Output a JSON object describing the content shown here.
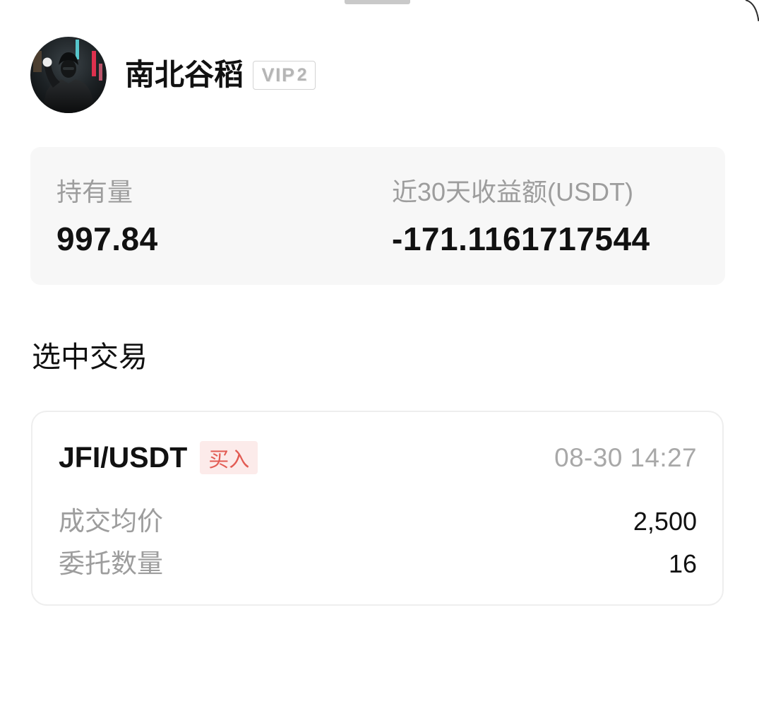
{
  "profile": {
    "name": "南北谷稻",
    "vip": {
      "prefix": "VIP",
      "level": "2"
    }
  },
  "stats": {
    "holdings": {
      "label": "持有量",
      "value": "997.84"
    },
    "pnl_30d": {
      "label": "近30天收益额(USDT)",
      "value": "-171.1161717544"
    }
  },
  "section": {
    "title": "选中交易"
  },
  "trade": {
    "pair": "JFI/USDT",
    "side": "买入",
    "time": "08-30 14:27",
    "rows": [
      {
        "label": "成交均价",
        "value": "2,500"
      },
      {
        "label": "委托数量",
        "value": "16"
      }
    ]
  },
  "colors": {
    "text_primary": "#111111",
    "text_secondary": "#9d9d9d",
    "text_muted": "#a8a8a8",
    "card_bg": "#f7f7f7",
    "card_border": "#eeeeee",
    "buy_bg": "#fcebea",
    "buy_text": "#e25b53",
    "handle": "#c9c9c9"
  }
}
